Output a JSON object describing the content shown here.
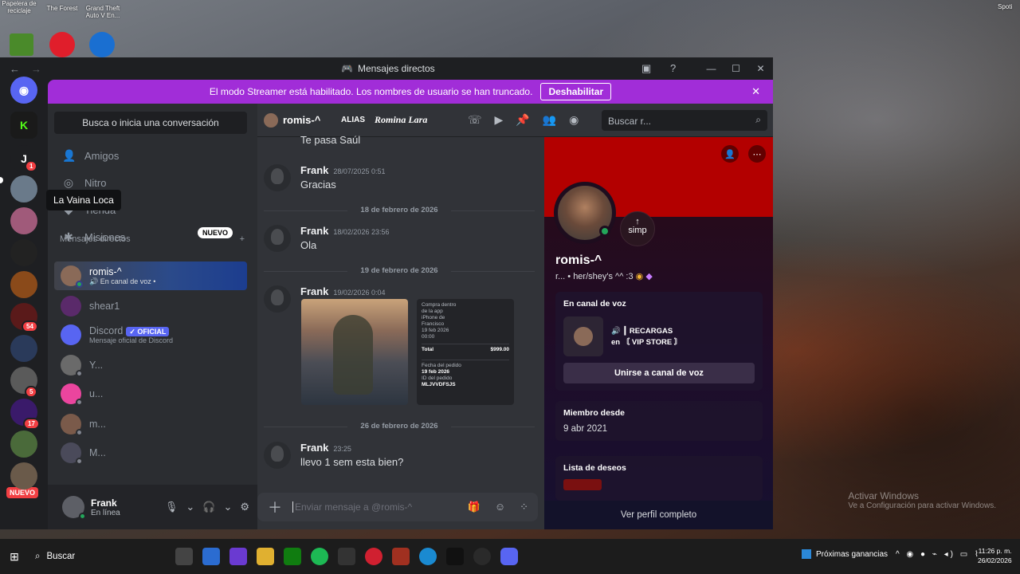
{
  "desktop": {
    "icons": [
      {
        "label": "Papelera de reciclaje"
      },
      {
        "label": "The Forest"
      },
      {
        "label": "Grand Theft Auto V En..."
      }
    ],
    "corner_label": "Spoti",
    "watermark_title": "Activar Windows",
    "watermark_sub": "Ve a Configuración para activar Windows."
  },
  "window": {
    "title": "Mensajes directos",
    "back_icon": "arrow-left",
    "forward_icon": "arrow-right"
  },
  "banner": {
    "text": "El modo Streamer está habilitado. Los nombres de usuario se han truncado.",
    "button": "Deshabilitar"
  },
  "rail": {
    "badges": [
      "1",
      "54",
      "5",
      "17"
    ],
    "new_label": "NUEVO",
    "letter_server": "J"
  },
  "sidebar": {
    "search": "Busca o inicia una conversación",
    "nav": [
      {
        "label": "Amigos",
        "icon": "person-wave"
      },
      {
        "label": "Nitro",
        "icon": "nitro"
      },
      {
        "label": "Tienda",
        "icon": "shop"
      },
      {
        "label": "Misiones",
        "icon": "quest"
      }
    ],
    "tooltip": "La Vaina Loca",
    "new_tag": "NUEVO",
    "dm_header": "Mensajes directos",
    "dm_add": "+",
    "dms": [
      {
        "name": "romis-^",
        "sub": "En canal de voz •",
        "status": "online",
        "active": true
      },
      {
        "name": "shear1",
        "sub": "",
        "status": "none"
      },
      {
        "name": "Discord",
        "sub": "Mensaje oficial de Discord",
        "badge": "OFICIAL",
        "status": "none"
      },
      {
        "name": "Y...",
        "sub": "",
        "status": "offline"
      },
      {
        "name": "u...",
        "sub": "",
        "status": "offline"
      },
      {
        "name": "m...",
        "sub": "",
        "status": "offline"
      },
      {
        "name": "M...",
        "sub": "",
        "status": "offline"
      }
    ]
  },
  "user": {
    "name": "Frank",
    "status": "En línea"
  },
  "chat_header": {
    "name": "romis-^",
    "alias_label": "ALIAS",
    "alias_value": "Romina Lara",
    "search_placeholder": "Buscar r..."
  },
  "messages": [
    {
      "type": "text",
      "text": "Te pasa Saúl"
    },
    {
      "type": "msg",
      "author": "Frank",
      "time": "28/07/2025 0:51",
      "text": "Gracias"
    },
    {
      "type": "divider",
      "text": "18 de febrero de 2026"
    },
    {
      "type": "msg",
      "author": "Frank",
      "time": "18/02/2026 23:56",
      "text": "Ola"
    },
    {
      "type": "divider",
      "text": "19 de febrero de 2026"
    },
    {
      "type": "msg",
      "author": "Frank",
      "time": "19/02/2026 0:04",
      "text": ""
    },
    {
      "type": "divider",
      "text": "26 de febrero de 2026"
    },
    {
      "type": "msg",
      "author": "Frank",
      "time": "23:25",
      "text": "llevo 1 sem esta bien?"
    }
  ],
  "receipt": {
    "lines": [
      "Compra dentro",
      "de la app",
      "iPhone de",
      "Francisco",
      "19 feb 2026",
      "00:00"
    ],
    "total_label": "Total",
    "total_value": "$999.00",
    "date_label": "Fecha del pedido",
    "date_value": "19 feb 2026",
    "id_label": "ID del pedido",
    "id_value": "MLJVVDFSJS"
  },
  "composer": {
    "placeholder": "Enviar mensaje a @romis-^"
  },
  "profile": {
    "name": "romis-^",
    "meta": "r... • her/shey's ^^ :3",
    "bubble_arrow": "↑",
    "bubble": "simp",
    "voice_header": "En canal de voz",
    "voice_line1": "┃ RECARGAS",
    "voice_line2": "en 〘 VIP STORE 〙",
    "join_button": "Unirse a canal de voz",
    "member_header": "Miembro desde",
    "member_value": "9 abr 2021",
    "wishlist_header": "Lista de deseos",
    "full_profile": "Ver perfil completo"
  },
  "taskbar": {
    "search": "Buscar",
    "news": "Próximas ganancias",
    "time": "11:26 p. m.",
    "date": "26/02/2026"
  },
  "colors": {
    "streamer_banner": "#a12dd8",
    "profile_banner": "#b30000",
    "online": "#23a55a",
    "badge": "#f23f43"
  }
}
